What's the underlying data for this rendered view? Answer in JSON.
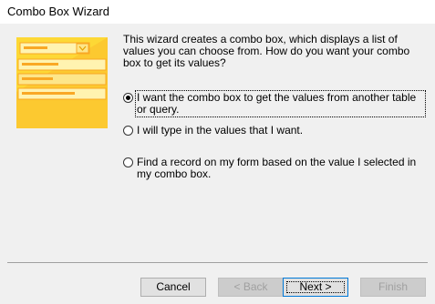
{
  "window": {
    "title": "Combo Box Wizard"
  },
  "intro_text": "This wizard creates a combo box, which displays a list of values you can choose from.  How do you want your combo box to get its values?",
  "options": [
    {
      "label": "I want the combo box to get the values from another table or query.",
      "selected": true
    },
    {
      "label": "I will type in the values that I want.",
      "selected": false
    },
    {
      "label": "Find a record on my form based on the value I selected in my combo box.",
      "selected": false
    }
  ],
  "buttons": {
    "cancel": "Cancel",
    "back": "< Back",
    "next": "Next >",
    "finish": "Finish"
  },
  "colors": {
    "illustration_yellow": "#fdd835",
    "illustration_light": "#fff3b0",
    "illustration_dark": "#f9a825",
    "dialog_bg": "#f0f0f0"
  }
}
